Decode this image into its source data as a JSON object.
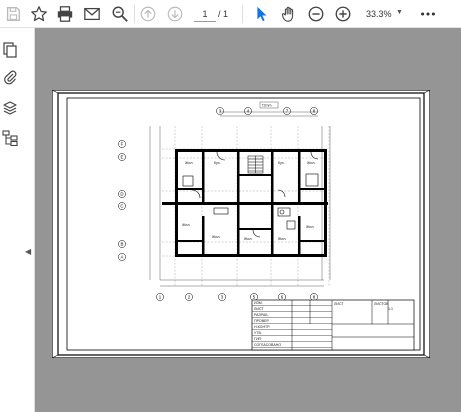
{
  "toolbar": {
    "page_current": "1",
    "page_separator": "/",
    "page_total": "1",
    "zoom": "33.3%",
    "icons": [
      "save-icon",
      "bookmark-star-icon",
      "print-icon",
      "email-icon",
      "search-zoom-icon",
      "page-up-icon",
      "page-down-icon",
      "select-cursor-icon",
      "hand-tool-icon",
      "zoom-out-icon",
      "zoom-in-icon",
      "more-icon"
    ],
    "accent_color": "#1473e6"
  },
  "sidebar": {
    "icons": [
      "pages-icon",
      "attachment-icon",
      "layers-icon",
      "structure-icon"
    ],
    "collapse_glyph": "◀"
  },
  "drawing": {
    "top_axis_labels": [
      "3",
      "4",
      "7",
      "8"
    ],
    "bottom_axis_labels": [
      "1",
      "2",
      "3",
      "5",
      "6",
      "8"
    ],
    "left_axis_labels": [
      "F",
      "E",
      "D",
      "C",
      "B",
      "A"
    ],
    "dim_label": "72mm",
    "title_block_rows": [
      "ИЗМ.",
      "ЛИСТ",
      "РАЗРАБ.",
      "ПРОВЕР.",
      "Н.КОНТР.",
      "УТВ.",
      "ГИП",
      "СОГЛАСОВАНО"
    ]
  }
}
